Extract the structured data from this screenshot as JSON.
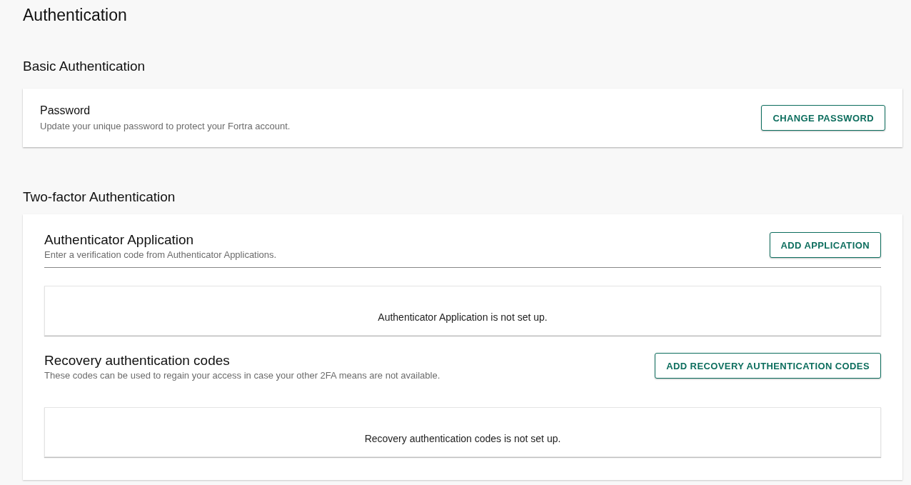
{
  "page_title": "Authentication",
  "basic": {
    "heading": "Basic Authentication",
    "title": "Password",
    "description": "Update your unique password to protect your Fortra account.",
    "button": "CHANGE PASSWORD"
  },
  "two_factor": {
    "heading": "Two-factor Authentication",
    "methods": [
      {
        "title": "Authenticator Application",
        "description": "Enter a verification code from Authenticator Applications.",
        "button": "ADD APPLICATION",
        "divider": true,
        "status": "Authenticator Application is not set up."
      },
      {
        "title": "Recovery authentication codes",
        "description": "These codes can be used to regain your access in case your other 2FA means are not available.",
        "button": "ADD RECOVERY AUTHENTICATION CODES",
        "divider": false,
        "status": "Recovery authentication codes is not set up."
      }
    ]
  }
}
